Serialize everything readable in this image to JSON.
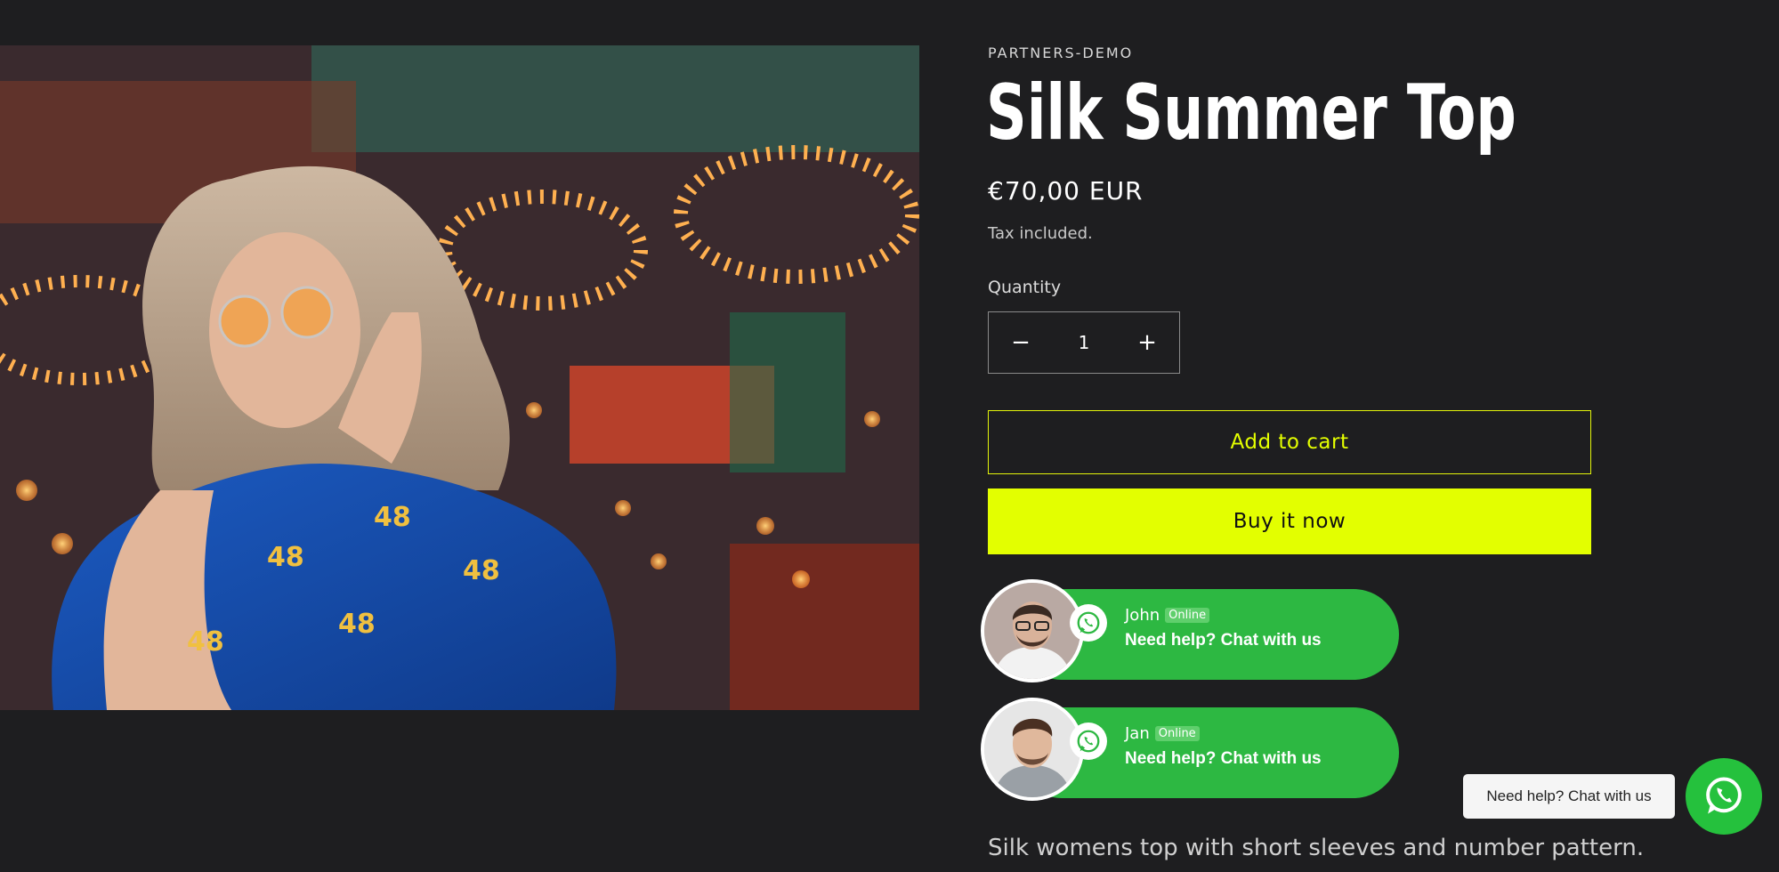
{
  "product": {
    "vendor": "PARTNERS-DEMO",
    "title": "Silk Summer Top",
    "price": "€70,00 EUR",
    "tax_note": "Tax included.",
    "quantity_label": "Quantity",
    "quantity_value": "1",
    "decrease_symbol": "−",
    "increase_symbol": "+",
    "add_to_cart_label": "Add to cart",
    "buy_now_label": "Buy it now",
    "description": "Silk womens top with short sleeves and number pattern."
  },
  "agents": [
    {
      "name": "John",
      "status": "Online",
      "help_text": "Need help? Chat with us"
    },
    {
      "name": "Jan",
      "status": "Online",
      "help_text": "Need help? Chat with us"
    }
  ],
  "floating_chat": {
    "bubble_text": "Need help? Chat with us",
    "icon": "whatsapp-icon"
  },
  "colors": {
    "background": "#1e1e20",
    "accent": "#e3ff00",
    "whatsapp_green": "#2db842"
  }
}
